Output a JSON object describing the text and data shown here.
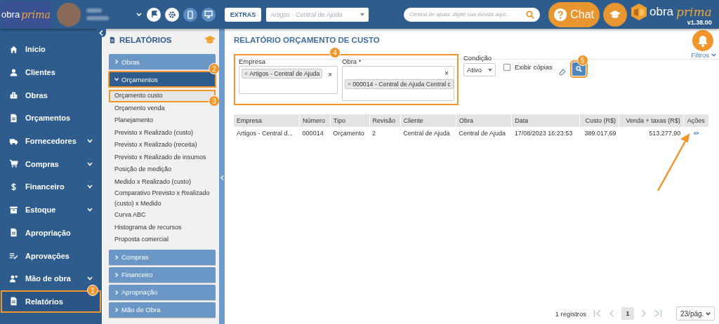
{
  "topbar": {
    "logo": {
      "word1": "obra",
      "word2": "prima"
    },
    "extras_button": "EXTRAS",
    "company_select": {
      "placeholder": "Artigos - Central de Ajuda"
    },
    "help_search": {
      "placeholder": "Central de ajuda: digite sua dúvida aqui..."
    },
    "chat_button": "Chat",
    "brand": {
      "word1": "obra",
      "word2": "prima",
      "version": "v1.38.00"
    }
  },
  "sidebar": {
    "items": [
      {
        "label": "Início",
        "kind": "home",
        "expandable": false,
        "selected": false
      },
      {
        "label": "Clientes",
        "kind": "user",
        "expandable": false,
        "selected": false
      },
      {
        "label": "Obras",
        "kind": "building",
        "expandable": false,
        "selected": false
      },
      {
        "label": "Orçamentos",
        "kind": "doc",
        "expandable": false,
        "selected": false
      },
      {
        "label": "Fornecedores",
        "kind": "truck",
        "expandable": true,
        "selected": false
      },
      {
        "label": "Compras",
        "kind": "cart",
        "expandable": true,
        "selected": false
      },
      {
        "label": "Financeiro",
        "kind": "dollar",
        "expandable": true,
        "selected": false
      },
      {
        "label": "Estoque",
        "kind": "box",
        "expandable": true,
        "selected": false
      },
      {
        "label": "Apropriação",
        "kind": "doc",
        "expandable": false,
        "selected": false
      },
      {
        "label": "Aprovações",
        "kind": "list",
        "expandable": false,
        "selected": false
      },
      {
        "label": "Mão de obra",
        "kind": "worker",
        "expandable": true,
        "selected": false
      },
      {
        "label": "Relatórios",
        "kind": "doc",
        "expandable": false,
        "selected": true,
        "callout": "1"
      }
    ]
  },
  "reports_panel": {
    "title": "RELATÓRIOS",
    "groups": [
      {
        "label": "Obras",
        "expanded": false
      },
      {
        "label": "Orçamentos",
        "expanded": true,
        "callout": "2",
        "items": [
          {
            "label": "Orçamento custo",
            "selected": true,
            "callout": "3"
          },
          {
            "label": "Orçamento venda",
            "selected": false
          },
          {
            "label": "Planejamento",
            "selected": false
          },
          {
            "label": "Previsto x Realizado (custo)",
            "selected": false
          },
          {
            "label": "Previsto x Realizado (receita)",
            "selected": false
          },
          {
            "label": "Previsto x Realizado de insumos",
            "selected": false
          },
          {
            "label": "Posição de medição",
            "selected": false
          },
          {
            "label": "Medido x Realizado (custo)",
            "selected": false
          },
          {
            "label": "Comparativo Previsto x Realizado (custo) x Medido",
            "selected": false
          },
          {
            "label": "Curva ABC",
            "selected": false
          },
          {
            "label": "Histograma de recursos",
            "selected": false
          },
          {
            "label": "Proposta comercial",
            "selected": false
          }
        ]
      },
      {
        "label": "Compras",
        "expanded": false
      },
      {
        "label": "Financeiro",
        "expanded": false
      },
      {
        "label": "Apropriação",
        "expanded": false
      },
      {
        "label": "Mão de Obra",
        "expanded": false
      }
    ]
  },
  "report": {
    "title": "RELATÓRIO ORÇAMENTO DE CUSTO",
    "filters_toggle": "Filtros",
    "filters": {
      "callout": "4",
      "empresa": {
        "label": "Empresa",
        "tags": [
          "Artigos - Central de Ajuda"
        ],
        "tag_remove": "×",
        "clear": "×"
      },
      "obra": {
        "label": "Obra *",
        "tags": [
          "000014 - Central de Ajuda Central c"
        ],
        "tag_remove": "×",
        "clear": "×"
      },
      "condicao": {
        "label": "Condição",
        "value": "Ativo"
      },
      "exibir_copias": {
        "label": "Exibir cópias",
        "checked": false
      },
      "search_callout": "5"
    },
    "table": {
      "columns": [
        {
          "label": "Empresa",
          "numeric": false
        },
        {
          "label": "Número",
          "numeric": false
        },
        {
          "label": "Tipo",
          "numeric": false
        },
        {
          "label": "Revisão",
          "numeric": false
        },
        {
          "label": "Cliente",
          "numeric": false
        },
        {
          "label": "Obra",
          "numeric": false
        },
        {
          "label": "Data",
          "numeric": false
        },
        {
          "label": "Custo (R$)",
          "numeric": true
        },
        {
          "label": "Venda + taxas (R$)",
          "numeric": true
        },
        {
          "label": "Ações",
          "numeric": false
        }
      ],
      "rows": [
        {
          "cells": [
            "Artigos - Central d...",
            "000014",
            "Orçamento",
            "2",
            "Central de Ajuda",
            "Central de Ajuda",
            "17/08/2023 16:23:53",
            "389.017,69",
            "513.277,90"
          ],
          "action_highlighted": true
        }
      ]
    },
    "pagination": {
      "count": "1 registros",
      "page": "1",
      "page_size": "23/pág."
    }
  }
}
